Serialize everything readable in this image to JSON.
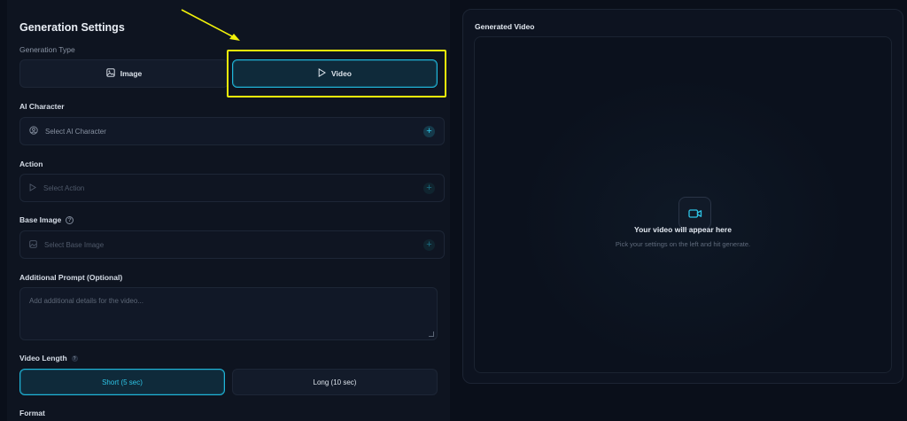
{
  "settings": {
    "title": "Generation Settings",
    "generation_type_label": "Generation Type",
    "type_options": [
      {
        "label": "Image",
        "icon": "image-icon"
      },
      {
        "label": "Video",
        "icon": "play-icon"
      }
    ],
    "selected_type": "Video",
    "ai_character": {
      "label": "AI Character",
      "placeholder": "Select AI Character"
    },
    "action": {
      "label": "Action",
      "placeholder": "Select Action"
    },
    "base_image": {
      "label": "Base Image",
      "placeholder": "Select Base Image"
    },
    "prompt": {
      "label": "Additional Prompt (Optional)",
      "placeholder": "Add additional details for the video..."
    },
    "video_length": {
      "label": "Video Length",
      "options": [
        "Short (5 sec)",
        "Long (10 sec)"
      ],
      "selected": "Short (5 sec)"
    },
    "format_label": "Format"
  },
  "preview": {
    "title": "Generated Video",
    "empty_title": "Your video will appear here",
    "empty_subtitle": "Pick your settings on the left and hit generate."
  },
  "colors": {
    "accent": "#1fb5d8",
    "highlight": "#f2f20a",
    "background": "#0a0f1a"
  }
}
